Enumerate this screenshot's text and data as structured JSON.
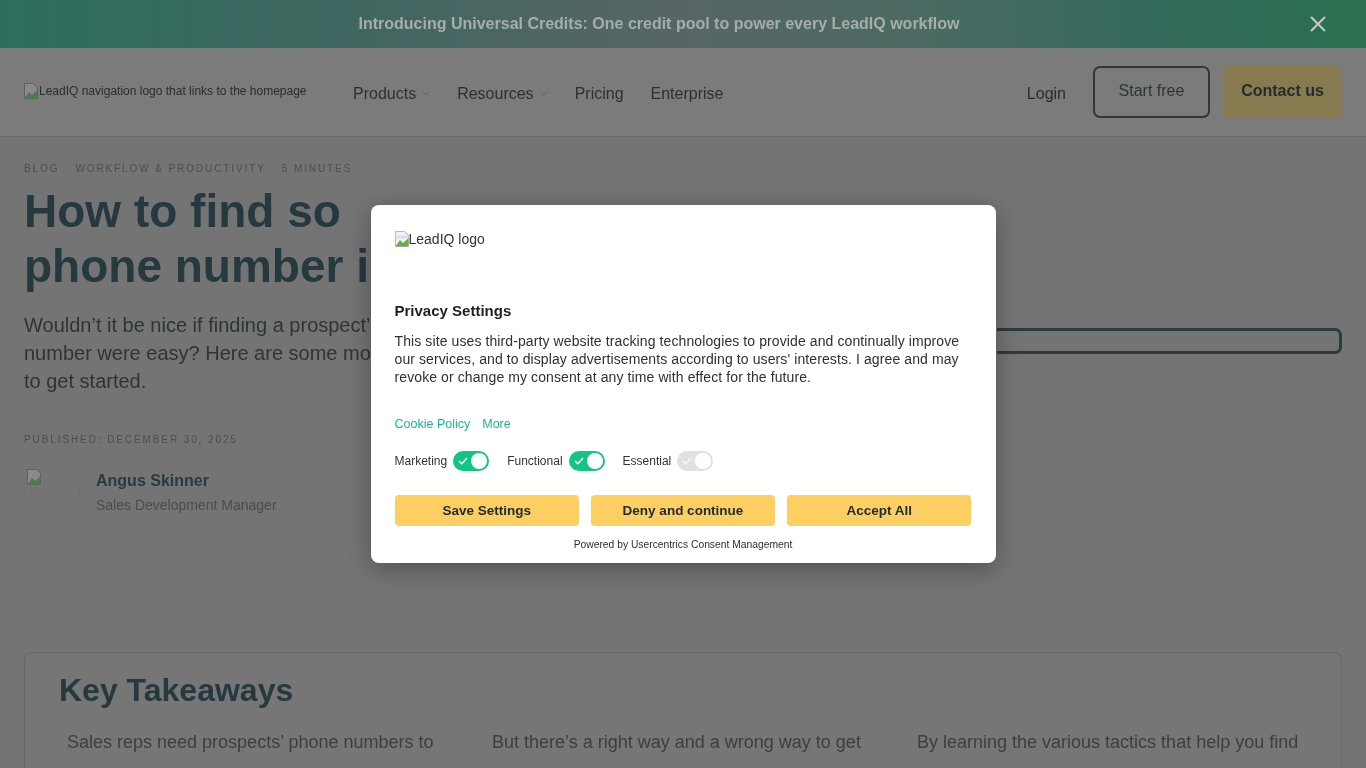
{
  "announcement_bar": {
    "text": "Introducing Universal Credits: One credit pool to power every LeadIQ workflow"
  },
  "nav": {
    "logo_alt": "LeadIQ navigation logo that links to the homepage",
    "links": [
      {
        "label": "Products",
        "dropdown": true
      },
      {
        "label": "Resources",
        "dropdown": true
      },
      {
        "label": "Pricing",
        "dropdown": false
      },
      {
        "label": "Enterprise",
        "dropdown": false
      }
    ],
    "login": "Login",
    "start_button": "Start free",
    "contact_button": "Contact us"
  },
  "article": {
    "breadcrumbs": [
      "BLOG",
      "WORKFLOW & PRODUCTIVITY",
      "5 MINUTES"
    ],
    "title_lines": [
      "How to find so",
      "phone number i"
    ],
    "intro_lines": [
      "Wouldn’t it be nice if finding a prospect’",
      "number were easy? Here are some mo",
      "to get started."
    ],
    "published": "PUBLISHED: DECEMBER 30, 2025",
    "author": {
      "name": "Angus Skinner",
      "role": "Sales Development Manager"
    }
  },
  "key_takeaways": {
    "title": "Key Takeaways",
    "columns": [
      "Sales reps need prospects’ phone numbers to",
      "But there’s a right way and a wrong way to get",
      "By learning the various tactics that help you find"
    ]
  },
  "consent_dialog": {
    "logo_alt": "LeadIQ logo",
    "title": "Privacy Settings",
    "body": "This site uses third-party website tracking technologies to provide and continually improve our services, and to display advertisements according to users' interests. I agree and may revoke or change my consent at any time with effect for the future.",
    "links": [
      "Cookie Policy",
      "More"
    ],
    "toggles": [
      {
        "label": "Marketing",
        "checked": true,
        "disabled": false
      },
      {
        "label": "Functional",
        "checked": true,
        "disabled": false
      },
      {
        "label": "Essential",
        "checked": true,
        "disabled": true
      }
    ],
    "buttons": [
      "Save Settings",
      "Deny and continue",
      "Accept All"
    ],
    "footer": "Powered by Usercentrics Consent Management"
  }
}
